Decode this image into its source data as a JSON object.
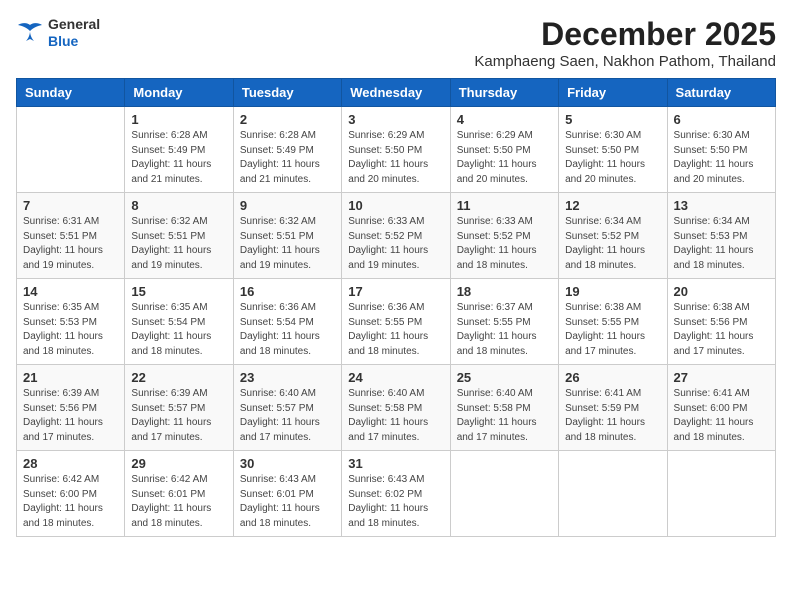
{
  "logo": {
    "line1": "General",
    "line2": "Blue"
  },
  "title": "December 2025",
  "subtitle": "Kamphaeng Saen, Nakhon Pathom, Thailand",
  "headers": [
    "Sunday",
    "Monday",
    "Tuesday",
    "Wednesday",
    "Thursday",
    "Friday",
    "Saturday"
  ],
  "weeks": [
    [
      {
        "day": "",
        "info": ""
      },
      {
        "day": "1",
        "info": "Sunrise: 6:28 AM\nSunset: 5:49 PM\nDaylight: 11 hours\nand 21 minutes."
      },
      {
        "day": "2",
        "info": "Sunrise: 6:28 AM\nSunset: 5:49 PM\nDaylight: 11 hours\nand 21 minutes."
      },
      {
        "day": "3",
        "info": "Sunrise: 6:29 AM\nSunset: 5:50 PM\nDaylight: 11 hours\nand 20 minutes."
      },
      {
        "day": "4",
        "info": "Sunrise: 6:29 AM\nSunset: 5:50 PM\nDaylight: 11 hours\nand 20 minutes."
      },
      {
        "day": "5",
        "info": "Sunrise: 6:30 AM\nSunset: 5:50 PM\nDaylight: 11 hours\nand 20 minutes."
      },
      {
        "day": "6",
        "info": "Sunrise: 6:30 AM\nSunset: 5:50 PM\nDaylight: 11 hours\nand 20 minutes."
      }
    ],
    [
      {
        "day": "7",
        "info": "Sunrise: 6:31 AM\nSunset: 5:51 PM\nDaylight: 11 hours\nand 19 minutes."
      },
      {
        "day": "8",
        "info": "Sunrise: 6:32 AM\nSunset: 5:51 PM\nDaylight: 11 hours\nand 19 minutes."
      },
      {
        "day": "9",
        "info": "Sunrise: 6:32 AM\nSunset: 5:51 PM\nDaylight: 11 hours\nand 19 minutes."
      },
      {
        "day": "10",
        "info": "Sunrise: 6:33 AM\nSunset: 5:52 PM\nDaylight: 11 hours\nand 19 minutes."
      },
      {
        "day": "11",
        "info": "Sunrise: 6:33 AM\nSunset: 5:52 PM\nDaylight: 11 hours\nand 18 minutes."
      },
      {
        "day": "12",
        "info": "Sunrise: 6:34 AM\nSunset: 5:52 PM\nDaylight: 11 hours\nand 18 minutes."
      },
      {
        "day": "13",
        "info": "Sunrise: 6:34 AM\nSunset: 5:53 PM\nDaylight: 11 hours\nand 18 minutes."
      }
    ],
    [
      {
        "day": "14",
        "info": "Sunrise: 6:35 AM\nSunset: 5:53 PM\nDaylight: 11 hours\nand 18 minutes."
      },
      {
        "day": "15",
        "info": "Sunrise: 6:35 AM\nSunset: 5:54 PM\nDaylight: 11 hours\nand 18 minutes."
      },
      {
        "day": "16",
        "info": "Sunrise: 6:36 AM\nSunset: 5:54 PM\nDaylight: 11 hours\nand 18 minutes."
      },
      {
        "day": "17",
        "info": "Sunrise: 6:36 AM\nSunset: 5:55 PM\nDaylight: 11 hours\nand 18 minutes."
      },
      {
        "day": "18",
        "info": "Sunrise: 6:37 AM\nSunset: 5:55 PM\nDaylight: 11 hours\nand 18 minutes."
      },
      {
        "day": "19",
        "info": "Sunrise: 6:38 AM\nSunset: 5:55 PM\nDaylight: 11 hours\nand 17 minutes."
      },
      {
        "day": "20",
        "info": "Sunrise: 6:38 AM\nSunset: 5:56 PM\nDaylight: 11 hours\nand 17 minutes."
      }
    ],
    [
      {
        "day": "21",
        "info": "Sunrise: 6:39 AM\nSunset: 5:56 PM\nDaylight: 11 hours\nand 17 minutes."
      },
      {
        "day": "22",
        "info": "Sunrise: 6:39 AM\nSunset: 5:57 PM\nDaylight: 11 hours\nand 17 minutes."
      },
      {
        "day": "23",
        "info": "Sunrise: 6:40 AM\nSunset: 5:57 PM\nDaylight: 11 hours\nand 17 minutes."
      },
      {
        "day": "24",
        "info": "Sunrise: 6:40 AM\nSunset: 5:58 PM\nDaylight: 11 hours\nand 17 minutes."
      },
      {
        "day": "25",
        "info": "Sunrise: 6:40 AM\nSunset: 5:58 PM\nDaylight: 11 hours\nand 17 minutes."
      },
      {
        "day": "26",
        "info": "Sunrise: 6:41 AM\nSunset: 5:59 PM\nDaylight: 11 hours\nand 18 minutes."
      },
      {
        "day": "27",
        "info": "Sunrise: 6:41 AM\nSunset: 6:00 PM\nDaylight: 11 hours\nand 18 minutes."
      }
    ],
    [
      {
        "day": "28",
        "info": "Sunrise: 6:42 AM\nSunset: 6:00 PM\nDaylight: 11 hours\nand 18 minutes."
      },
      {
        "day": "29",
        "info": "Sunrise: 6:42 AM\nSunset: 6:01 PM\nDaylight: 11 hours\nand 18 minutes."
      },
      {
        "day": "30",
        "info": "Sunrise: 6:43 AM\nSunset: 6:01 PM\nDaylight: 11 hours\nand 18 minutes."
      },
      {
        "day": "31",
        "info": "Sunrise: 6:43 AM\nSunset: 6:02 PM\nDaylight: 11 hours\nand 18 minutes."
      },
      {
        "day": "",
        "info": ""
      },
      {
        "day": "",
        "info": ""
      },
      {
        "day": "",
        "info": ""
      }
    ]
  ]
}
